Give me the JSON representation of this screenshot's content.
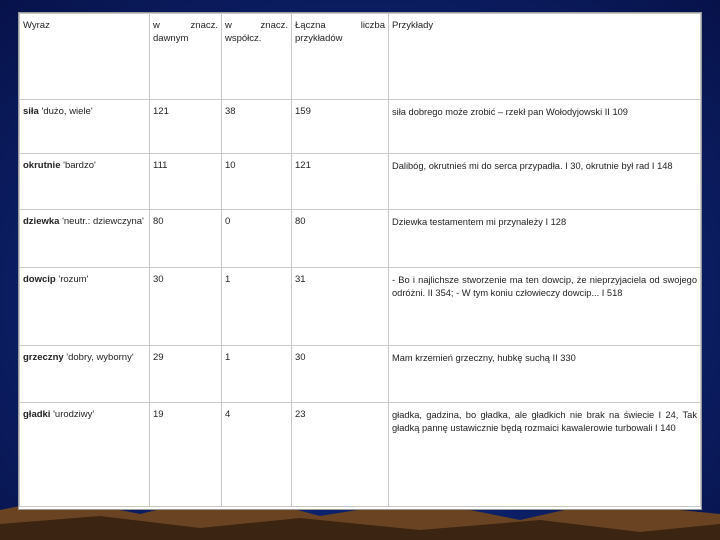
{
  "header": {
    "word": "Wyraz",
    "old_meaning": "w znacz. dawnym",
    "modern_meaning": "w znacz. współcz.",
    "total": "Łączna liczba przykładów",
    "examples": "Przykłady"
  },
  "rows": [
    {
      "word": "siła",
      "gloss": "'dużo, wiele'",
      "old": "121",
      "modern": "38",
      "total": "159",
      "example": "siła dobrego może zrobić – rzekł pan Wołodyjowski II 109"
    },
    {
      "word": "okrutnie",
      "gloss": "'bardzo'",
      "old": "111",
      "modern": "10",
      "total": "121",
      "example": "Dalibóg, okrutnieś mi do serca przypadła. I 30, okrutnie był rad I 148"
    },
    {
      "word": "dziewka",
      "gloss": "'neutr.: dziewczyna'",
      "old": "80",
      "modern": "0",
      "total": "80",
      "example": "Dziewka testamentem mi przynależy I 128"
    },
    {
      "word": "dowcip",
      "gloss": "'rozum'",
      "old": "30",
      "modern": "1",
      "total": "31",
      "example": "- Bo i najlichsze stworzenie ma ten dowcip, że nieprzyjaciela od swojego odróżni. II 354; - W tym koniu człowieczy dowcip... I 518"
    },
    {
      "word": "grzeczny",
      "gloss": "'dobry, wyborny'",
      "old": "29",
      "modern": "1",
      "total": "30",
      "example": "Mam krzemień grzeczny, hubkę suchą II 330"
    },
    {
      "word": "gładki",
      "gloss": "'urodziwy'",
      "old": "19",
      "modern": "4",
      "total": "23",
      "example": "gładka, gadzina, bo gładka, ale gładkich nie brak na świecie I 24, Tak gładką pannę ustawicznie będą rozmaici kawalerowie turbowali I 140"
    }
  ]
}
